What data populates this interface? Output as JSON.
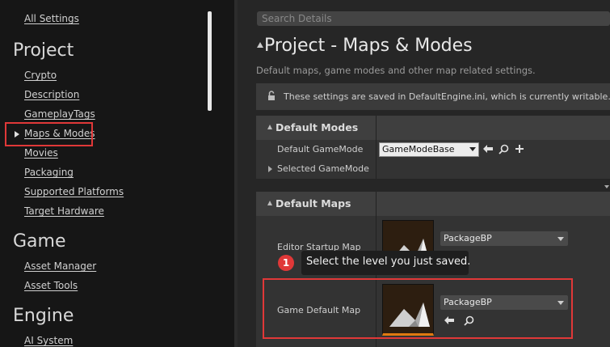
{
  "sidebar": {
    "all_settings": "All Settings",
    "sections": {
      "project": "Project",
      "game": "Game",
      "engine": "Engine"
    },
    "project_items": [
      "Crypto",
      "Description",
      "GameplayTags",
      "Maps & Modes",
      "Movies",
      "Packaging",
      "Supported Platforms",
      "Target Hardware"
    ],
    "game_items": [
      "Asset Manager",
      "Asset Tools"
    ],
    "engine_items": [
      "AI System"
    ],
    "selected_item": "Maps & Modes"
  },
  "search": {
    "placeholder": "Search Details"
  },
  "main": {
    "title": "Project - Maps & Modes",
    "subtitle": "Default maps, game modes and other map related settings.",
    "notice": "These settings are saved in DefaultEngine.ini, which is currently writable."
  },
  "default_modes": {
    "header": "Default Modes",
    "default_gamemode_label": "Default GameMode",
    "default_gamemode_value": "GameModeBase",
    "selected_gamemode_label": "Selected GameMode"
  },
  "default_maps": {
    "header": "Default Maps",
    "editor_startup_label": "Editor Startup Map",
    "editor_startup_value": "PackageBP",
    "game_default_label": "Game Default Map",
    "game_default_value": "PackageBP"
  },
  "tooltip": {
    "step": "1",
    "text": "Select the level you just saved."
  },
  "colors": {
    "highlight": "#e03838",
    "panel_bg": "#262626",
    "sidebar_bg": "#161616"
  }
}
